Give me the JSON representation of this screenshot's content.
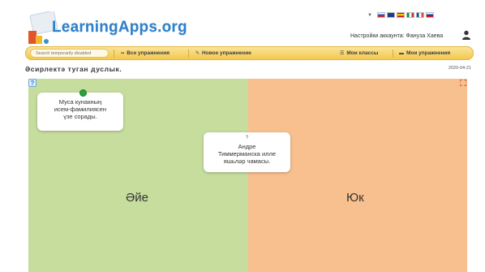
{
  "header": {
    "logo_text": "LearningApps.org",
    "account_label": "Настройки аккаунта: Фануза Хаева",
    "language_flags": [
      "russian-flag",
      "british-flag",
      "spanish-flag",
      "italian-flag",
      "french-flag",
      "slovenian-flag"
    ]
  },
  "navbar": {
    "search_placeholder": "Search temporarily disabled",
    "all_exercises": "Все упражнения",
    "new_exercise": "Новое упражнение",
    "my_classes": "Мои классы",
    "my_exercises": "Мои упражнения"
  },
  "app": {
    "title": "Әсирлектә туган дуслык.",
    "date": "2020-04-21",
    "left_label": "Әйе",
    "right_label": "Юк",
    "cards": [
      {
        "text_lines": [
          "Муса кунакның",
          "исем-фамилиясен",
          "үзе сорады."
        ]
      },
      {
        "marker": "?",
        "text_lines": [
          "Андре",
          "Тиммерманска илле",
          "яшьләр чамасы."
        ]
      }
    ]
  },
  "colors": {
    "accent_blue": "#2f80c8",
    "navbar_yellow": "#f3c84e",
    "zone_green": "#c6dd9e",
    "zone_orange": "#f7c08e",
    "pin_green": "#2aa33a"
  }
}
